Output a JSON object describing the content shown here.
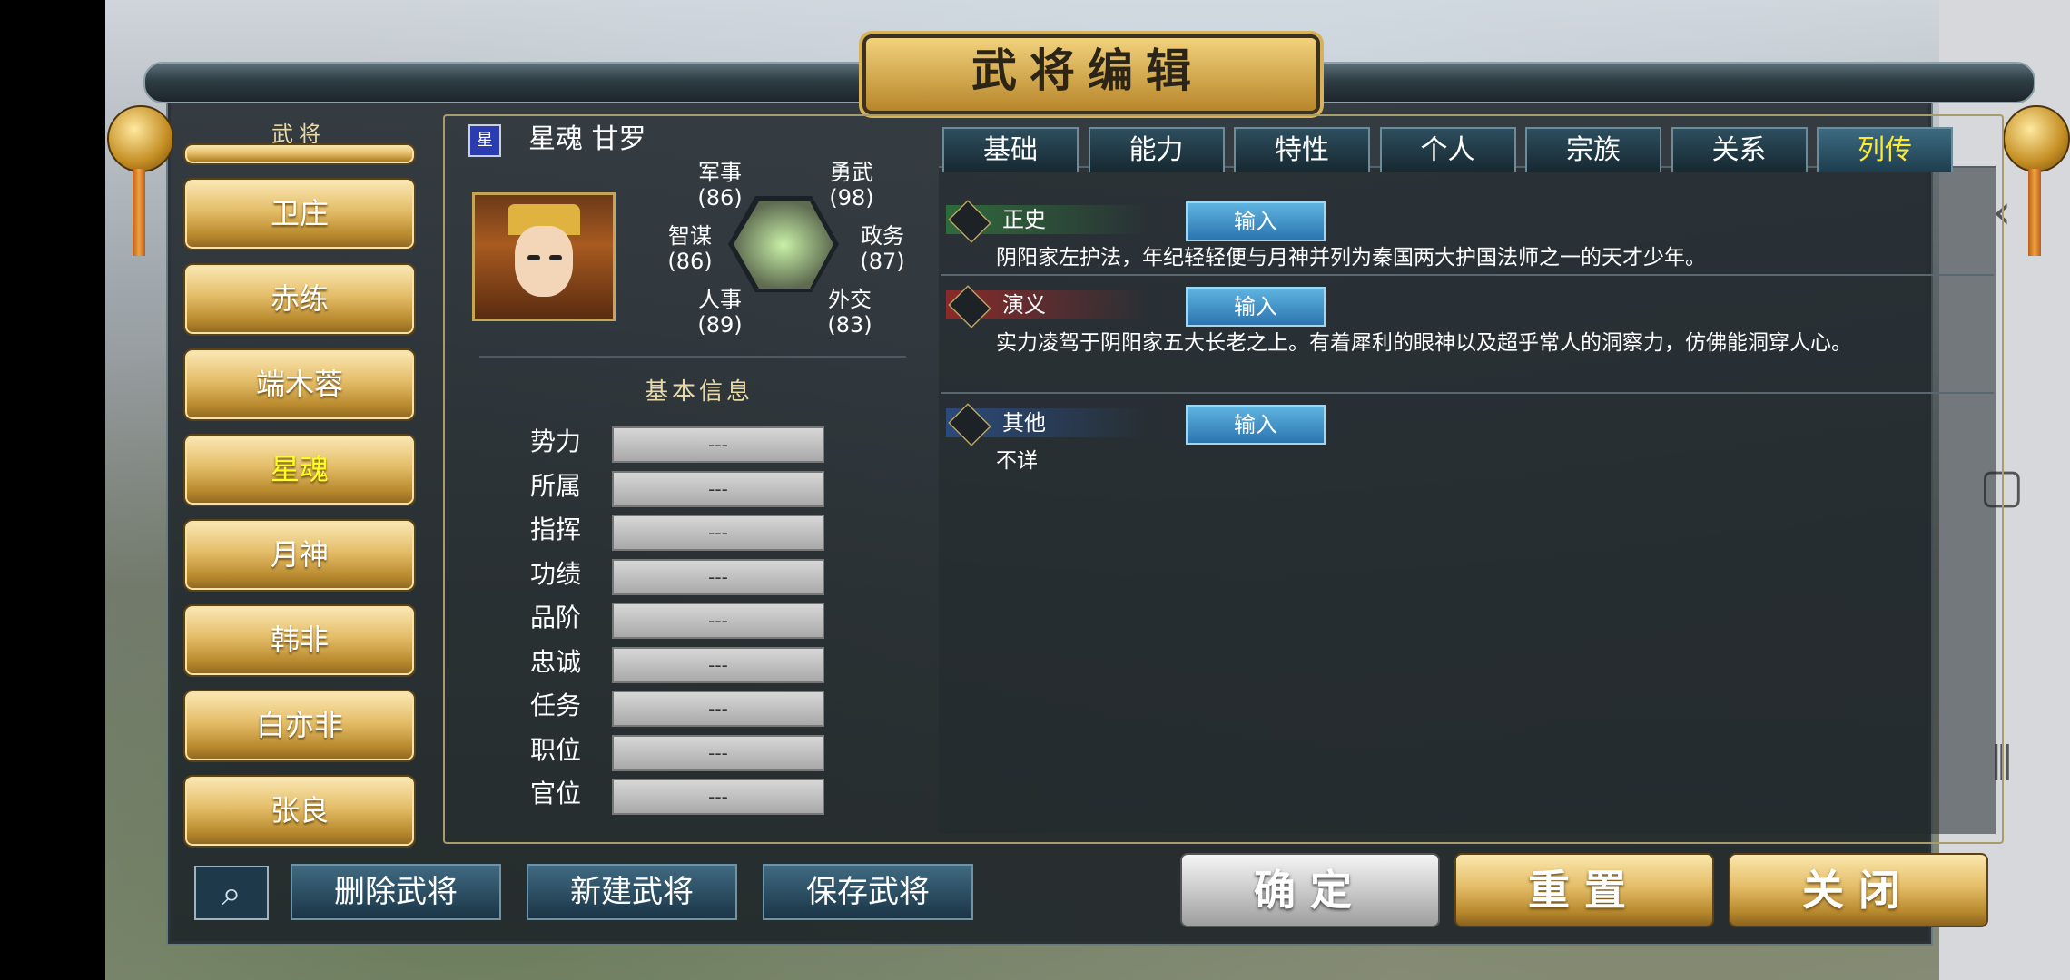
{
  "window": {
    "title": "武将编辑"
  },
  "sidebar": {
    "header": "武将",
    "items": [
      {
        "label": "卫庄",
        "selected": false
      },
      {
        "label": "赤练",
        "selected": false
      },
      {
        "label": "端木蓉",
        "selected": false
      },
      {
        "label": "星魂",
        "selected": true
      },
      {
        "label": "月神",
        "selected": false
      },
      {
        "label": "韩非",
        "selected": false
      },
      {
        "label": "白亦非",
        "selected": false
      },
      {
        "label": "张良",
        "selected": false
      }
    ]
  },
  "general": {
    "badge": "星",
    "name": "星魂 甘罗",
    "stats": {
      "military": {
        "label": "军事",
        "value": "(86)"
      },
      "valor": {
        "label": "勇武",
        "value": "(98)"
      },
      "intellect": {
        "label": "智谋",
        "value": "(86)"
      },
      "politics": {
        "label": "政务",
        "value": "(87)"
      },
      "personnel": {
        "label": "人事",
        "value": "(89)"
      },
      "diplomacy": {
        "label": "外交",
        "value": "(83)"
      }
    }
  },
  "basic_info": {
    "header": "基本信息",
    "rows": [
      {
        "label": "势力",
        "value": "---"
      },
      {
        "label": "所属",
        "value": "---"
      },
      {
        "label": "指挥",
        "value": "---"
      },
      {
        "label": "功绩",
        "value": "---"
      },
      {
        "label": "品阶",
        "value": "---"
      },
      {
        "label": "忠诚",
        "value": "---"
      },
      {
        "label": "任务",
        "value": "---"
      },
      {
        "label": "职位",
        "value": "---"
      },
      {
        "label": "官位",
        "value": "---"
      }
    ]
  },
  "tabs": [
    {
      "label": "基础",
      "active": false
    },
    {
      "label": "能力",
      "active": false
    },
    {
      "label": "特性",
      "active": false
    },
    {
      "label": "个人",
      "active": false
    },
    {
      "label": "宗族",
      "active": false
    },
    {
      "label": "关系",
      "active": false
    },
    {
      "label": "列传",
      "active": true
    }
  ],
  "biography": {
    "input_label": "输入",
    "sections": [
      {
        "label": "正史",
        "color": "#2f6b3a",
        "text": "阴阳家左护法，年纪轻轻便与月神并列为秦国两大护国法师之一的天才少年。"
      },
      {
        "label": "演义",
        "color": "#8a2a2a",
        "text": "实力凌驾于阴阳家五大长老之上。有着犀利的眼神以及超乎常人的洞察力，仿佛能洞穿人心。"
      },
      {
        "label": "其他",
        "color": "#2a4a7a",
        "text": "不详"
      }
    ]
  },
  "bottom_bar": {
    "delete_label": "删除武将",
    "new_label": "新建武将",
    "save_label": "保存武将",
    "confirm_label": "确定",
    "reset_label": "重置",
    "close_label": "关闭"
  },
  "colors": {
    "accent_gold": "#e4bd68",
    "selected_text": "#ffff20",
    "tab_active_text": "#ffe830"
  }
}
